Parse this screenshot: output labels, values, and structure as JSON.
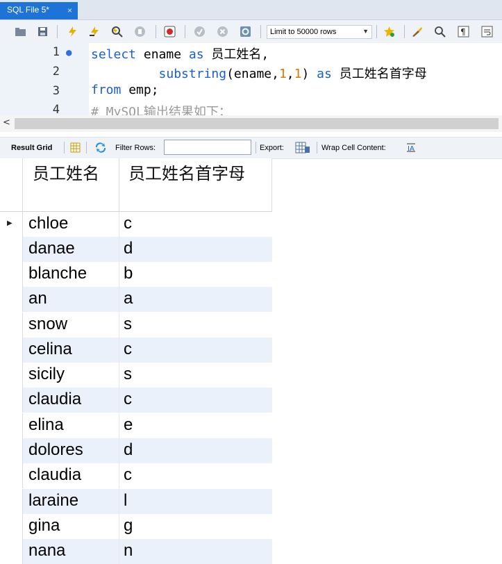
{
  "tab": {
    "title": "SQL File 5*",
    "close": "×"
  },
  "toolbar": {
    "limit_label": "Limit to 50000 rows",
    "icons": [
      "folder-icon",
      "save-icon",
      "execute-icon",
      "execute-current-icon",
      "explain-icon",
      "stop-icon",
      "toggle-error-icon",
      "commit-icon",
      "rollback-icon",
      "autocommit-icon",
      "limit-dropdown",
      "beautify-icon",
      "find-icon",
      "invisible-chars-icon",
      "wrap-icon",
      "bookmark-icon"
    ]
  },
  "editor": {
    "lines": [
      {
        "num": "1",
        "has_marker": true
      },
      {
        "num": "2"
      },
      {
        "num": "3"
      },
      {
        "num": "4"
      }
    ],
    "code": {
      "l1_kw1": "select",
      "l1_rest1": " ename ",
      "l1_kw2": "as",
      "l1_rest2": " 员工姓名,",
      "l2_indent": "         ",
      "l2_func": "substring",
      "l2_open": "(ename,",
      "l2_n1": "1",
      "l2_comma": ",",
      "l2_n2": "1",
      "l2_close": ") ",
      "l2_kw": "as",
      "l2_alias": " 员工姓名首字母",
      "l3_kw": "from",
      "l3_rest": " emp;",
      "l4_comment": "# MySQL输出结果如下："
    }
  },
  "result_bar": {
    "result_grid": "Result Grid",
    "filter_rows": "Filter Rows:",
    "filter_value": "",
    "export": "Export:",
    "wrap": "Wrap Cell Content:"
  },
  "grid": {
    "headers": [
      "员工姓名",
      "员工姓名首字母"
    ],
    "rows": [
      [
        "chloe",
        "c"
      ],
      [
        "danae",
        "d"
      ],
      [
        "blanche",
        "b"
      ],
      [
        "an",
        "a"
      ],
      [
        "snow",
        "s"
      ],
      [
        "celina",
        "c"
      ],
      [
        "sicily",
        "s"
      ],
      [
        "claudia",
        "c"
      ],
      [
        "elina",
        "e"
      ],
      [
        "dolores",
        "d"
      ],
      [
        "claudia",
        "c"
      ],
      [
        "laraine",
        "l"
      ],
      [
        "gina",
        "g"
      ],
      [
        "nana",
        "n"
      ]
    ]
  },
  "colors": {
    "keyword": "#1a5fcc",
    "number": "#e07800",
    "comment": "#9a9a9a",
    "tab": "#1e73d6",
    "alt_row": "#eaf1fb"
  }
}
